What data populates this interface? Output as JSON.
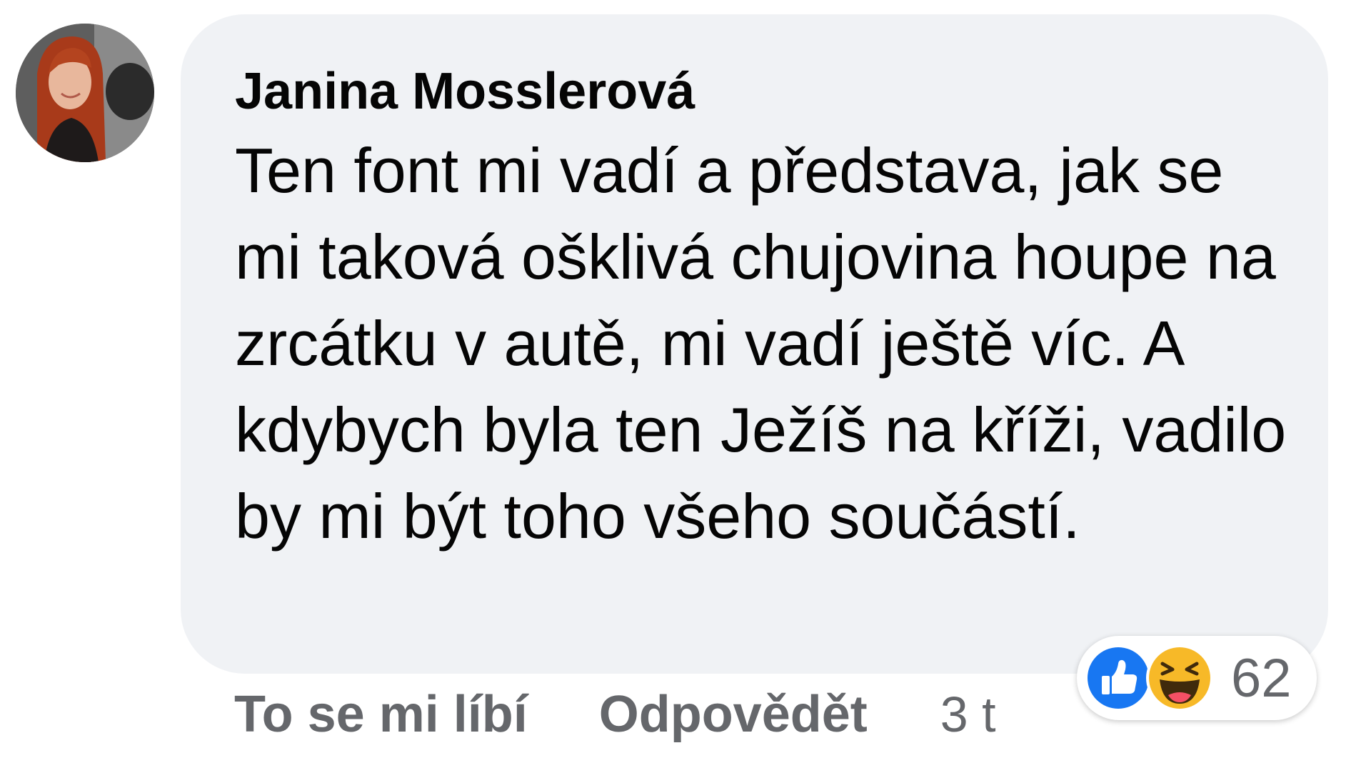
{
  "comment": {
    "author": "Janina Mosslerová",
    "text": "Ten font mi vadí a představa, jak se mi taková ošklivá chujovina houpe na zrcátku v autě, mi vadí ještě víc. A kdybych byla ten Ježíš na kříži, vadilo by mi být toho všeho součástí.",
    "avatar_icon": "profile-photo"
  },
  "actions": {
    "like_label": "To se mi líbí",
    "reply_label": "Odpovědět",
    "time": "3 t"
  },
  "reactions": {
    "icons": [
      "like-reaction-icon",
      "haha-reaction-icon"
    ],
    "count": "62",
    "colors": {
      "like": "#1877f2",
      "haha": "#f7b928"
    }
  }
}
